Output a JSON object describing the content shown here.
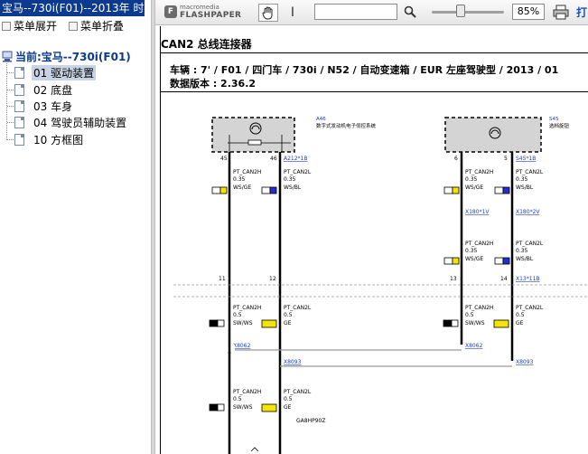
{
  "window": {
    "title": "宝马--730i(F01)--2013年 时"
  },
  "menu": {
    "expand_label": "菜单展开",
    "collapse_label": "菜单折叠"
  },
  "tree": {
    "root_label": "当前:宝马--730i(F01)",
    "items": [
      {
        "label": "01 驱动装置",
        "selected": true
      },
      {
        "label": "02 底盘",
        "selected": false
      },
      {
        "label": "03 车身",
        "selected": false
      },
      {
        "label": "04 驾驶员辅助装置",
        "selected": false
      },
      {
        "label": "10 方框图",
        "selected": false
      }
    ]
  },
  "toolbar": {
    "logo_line1": "macromedia",
    "logo_line2": "FLASHPAPER",
    "search_value": "",
    "zoom": "85%",
    "zoom_fraction": 0.4,
    "print_label": "打"
  },
  "document": {
    "title": "CAN2 总线连接器",
    "vehicle_line": "车辆 :   7' / F01 / 四门车 / 730i / N52 / 自动变速箱  / EUR 左座驾驶型 / 2013 / 01",
    "data_version": "数据版本 :  2.36.2",
    "components": [
      {
        "id": "A46",
        "name": "数字式发动机电子伺控系统"
      },
      {
        "id": "S45",
        "name": "选档旋钮"
      }
    ],
    "pins": {
      "p45": "45",
      "p46": "46",
      "p6": "6",
      "p5": "5",
      "p11": "11",
      "p12": "12",
      "p13": "13",
      "p14": "14"
    },
    "connectors": {
      "a212": "A212*1B",
      "s45": "S45*1B",
      "x180_1v": "X180*1V",
      "x180_2v": "X180*2V",
      "x13": "X13*11B",
      "x8062a": "X8062",
      "x8062b": "X8062",
      "x8093a": "X8093",
      "x8093b": "X8093"
    },
    "wires": {
      "w1": {
        "name": "PT_CAN2H",
        "size": "0.35",
        "color": "WS/GE"
      },
      "w2": {
        "name": "PT_CAN2L",
        "size": "0.35",
        "color": "WS/BL"
      },
      "w3": {
        "name": "PT_CAN2H",
        "size": "0.35",
        "color": "WS/GE"
      },
      "w4": {
        "name": "PT_CAN2L",
        "size": "0.35",
        "color": "WS/BL"
      },
      "w5": {
        "name": "PT_CAN2H",
        "size": "0.35",
        "color": "WS/GE"
      },
      "w6": {
        "name": "PT_CAN2L",
        "size": "0.35",
        "color": "WS/BL"
      },
      "w7": {
        "name": "PT_CAN2H",
        "size": "0.5",
        "color": "SW/WS"
      },
      "w8": {
        "name": "PT_CAN2L",
        "size": "0.5",
        "color": "GE"
      },
      "w9": {
        "name": "PT_CAN2H",
        "size": "0.5",
        "color": "SW/WS"
      },
      "w10": {
        "name": "PT_CAN2L",
        "size": "0.5",
        "color": "GE"
      },
      "w11": {
        "name": "PT_CAN2H",
        "size": "0.5",
        "color": "SW/WS"
      },
      "w12": {
        "name": "PT_CAN2L",
        "size": "0.5",
        "color": "GE"
      }
    },
    "gearbox_label": "GA8HP90Z"
  },
  "colors": {
    "title_bar": "#0b3a8f",
    "tree_selected": "#c8d4e6",
    "wire_white": "#ffffff",
    "wire_yellow": "#f5e400",
    "wire_blue": "#1f2fd1",
    "wire_black": "#000000",
    "link_blue": "#2040c0",
    "component_fill": "#d4d4d4",
    "print_label": "#1a4fb0"
  },
  "icons": {
    "hand_tool": "hand-icon",
    "text_select": "text-cursor-icon",
    "search": "magnifier-icon",
    "print": "printer-icon",
    "tree_root": "computer-icon",
    "tree_doc": "document-icon"
  }
}
